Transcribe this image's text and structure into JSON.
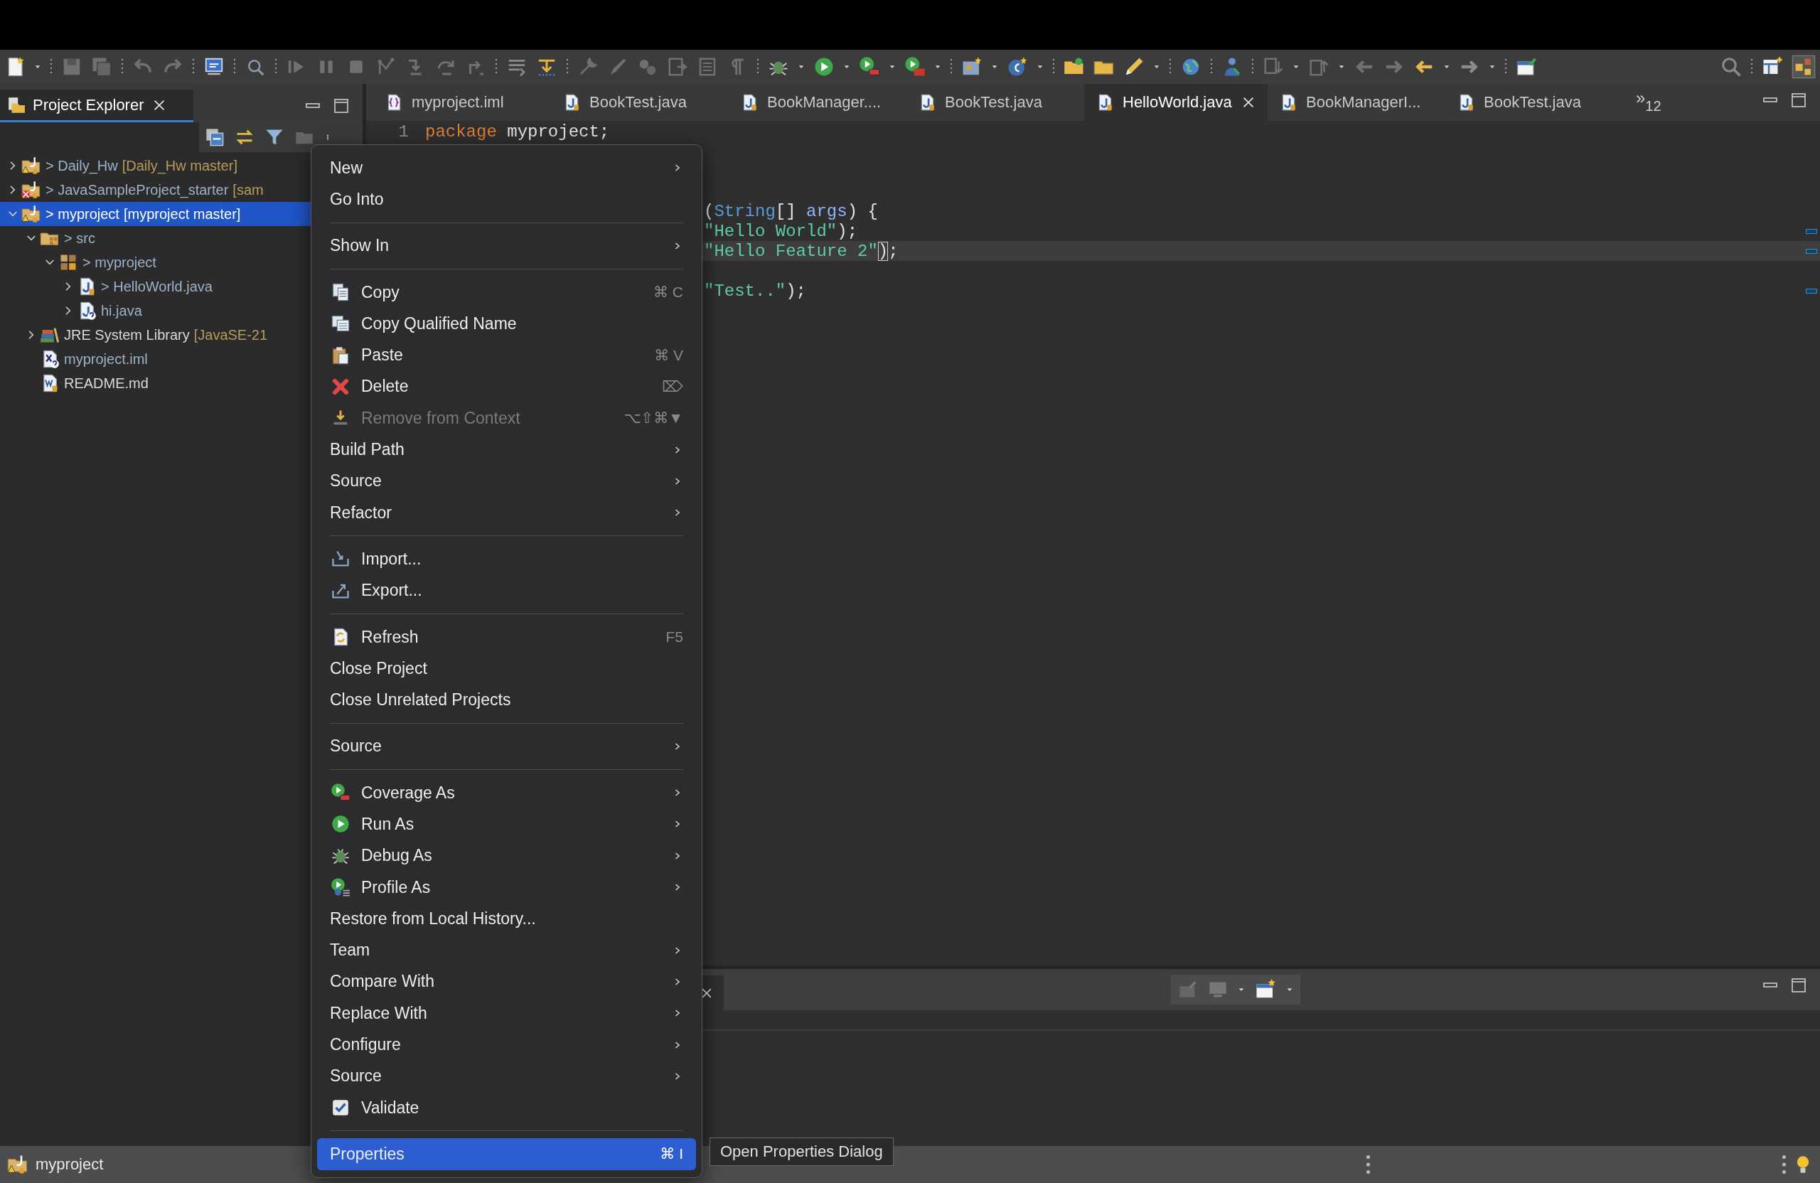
{
  "explorer": {
    "title": "Project Explorer",
    "tree": [
      {
        "label": "> Daily_Hw",
        "decoration": "[Daily_Hw master]",
        "kind": "project",
        "changed": true,
        "selected": false,
        "expanded": false
      },
      {
        "label": "> JavaSampleProject_starter",
        "decoration": "[sam",
        "kind": "project-error",
        "changed": true,
        "selected": false,
        "expanded": false
      },
      {
        "label": "> myproject",
        "decoration": "[myproject master]",
        "kind": "project",
        "changed": true,
        "selected": true,
        "expanded": true,
        "children": [
          {
            "label": "> src",
            "kind": "source-folder",
            "changed": true,
            "selected": false,
            "expanded": true,
            "children": [
              {
                "label": "> myproject",
                "kind": "package",
                "changed": true,
                "selected": false,
                "expanded": true,
                "children": [
                  {
                    "label": "> HelloWorld.java",
                    "kind": "java",
                    "changed": true,
                    "selected": false,
                    "expanded": false
                  },
                  {
                    "label": "hi.java",
                    "kind": "java-untracked",
                    "changed": true,
                    "selected": false,
                    "expanded": false
                  }
                ]
              }
            ]
          },
          {
            "label": "JRE System Library",
            "decoration": "[JavaSE-21",
            "kind": "library",
            "changed": false,
            "selected": false,
            "expanded": false
          },
          {
            "label": "myproject.iml",
            "kind": "xml",
            "changed": true,
            "selected": false
          },
          {
            "label": "README.md",
            "kind": "markdown",
            "changed": false,
            "selected": false
          }
        ]
      }
    ]
  },
  "editor": {
    "tabs": [
      {
        "label": "myproject.iml",
        "kind": "iml",
        "selected": false
      },
      {
        "label": "BookTest.java",
        "kind": "java",
        "selected": false
      },
      {
        "label": "BookManager....",
        "kind": "java",
        "selected": false
      },
      {
        "label": "BookTest.java",
        "kind": "java",
        "selected": false
      },
      {
        "label": "HelloWorld.java",
        "kind": "java",
        "selected": true
      },
      {
        "label": "BookManagerI...",
        "kind": "java",
        "selected": false
      },
      {
        "label": "BookTest.java",
        "kind": "java",
        "selected": false
      }
    ],
    "overflow": {
      "chevron": "»",
      "count": "12"
    },
    "lines": [
      {
        "number": "1",
        "kind": "full",
        "current": false,
        "ruler_mark": false,
        "tokens": [
          {
            "kind": "keyword",
            "text": "package"
          },
          {
            "kind": "plain",
            "text": " myproject;"
          }
        ]
      },
      {
        "kind": "blank"
      },
      {
        "kind": "blank"
      },
      {
        "kind": "blank"
      },
      {
        "kind": "partial",
        "current": false,
        "ruler_mark": false,
        "tokens": [
          {
            "kind": "plain",
            "text": "("
          },
          {
            "kind": "type",
            "text": "String"
          },
          {
            "kind": "plain",
            "text": "[] "
          },
          {
            "kind": "param",
            "text": "args"
          },
          {
            "kind": "plain",
            "text": ") {"
          }
        ]
      },
      {
        "kind": "partial",
        "current": false,
        "ruler_mark": true,
        "tokens": [
          {
            "kind": "string",
            "text": "\"Hello World\""
          },
          {
            "kind": "plain",
            "text": ");"
          }
        ]
      },
      {
        "kind": "partial",
        "current": true,
        "ruler_mark": true,
        "tokens": [
          {
            "kind": "string",
            "text": "\"Hello Feature 2\""
          },
          {
            "kind": "match",
            "text": ")"
          },
          {
            "kind": "plain",
            "text": ";"
          }
        ]
      },
      {
        "kind": "blank"
      },
      {
        "kind": "partial",
        "current": false,
        "ruler_mark": true,
        "tokens": [
          {
            "kind": "string",
            "text": "\"Test..\""
          },
          {
            "kind": "plain",
            "text": ");"
          }
        ]
      }
    ]
  },
  "context_menu": {
    "groups": [
      {
        "items": [
          {
            "label": "New",
            "kind": "plain",
            "submenu": true,
            "selected": false
          },
          {
            "label": "Go Into",
            "kind": "plain",
            "submenu": false,
            "selected": false
          }
        ]
      },
      {
        "items": [
          {
            "label": "Show In",
            "kind": "plain",
            "submenu": true,
            "selected": false
          }
        ]
      },
      {
        "items": [
          {
            "label": "Copy",
            "kind": "copy",
            "shortcut": "⌘ C",
            "submenu": false,
            "selected": false
          },
          {
            "label": "Copy Qualified Name",
            "kind": "copy-name",
            "submenu": false,
            "selected": false
          },
          {
            "label": "Paste",
            "kind": "paste",
            "shortcut": "⌘ V",
            "submenu": false,
            "selected": false
          },
          {
            "label": "Delete",
            "kind": "delete",
            "shortcut": "⌦",
            "submenu": false,
            "selected": false
          },
          {
            "label": "Remove from Context",
            "kind": "remove",
            "shortcut": "⌥⇧⌘▼",
            "submenu": false,
            "selected": false,
            "disabled": true
          },
          {
            "label": "Build Path",
            "kind": "plain",
            "submenu": true,
            "selected": false
          },
          {
            "label": "Source",
            "kind": "plain",
            "submenu": true,
            "selected": false
          },
          {
            "label": "Refactor",
            "kind": "plain",
            "submenu": true,
            "selected": false
          }
        ]
      },
      {
        "items": [
          {
            "label": "Import...",
            "kind": "import",
            "submenu": false,
            "selected": false
          },
          {
            "label": "Export...",
            "kind": "export",
            "submenu": false,
            "selected": false
          }
        ]
      },
      {
        "items": [
          {
            "label": "Refresh",
            "kind": "refresh",
            "shortcut": "F5",
            "submenu": false,
            "selected": false
          },
          {
            "label": "Close Project",
            "kind": "plain",
            "submenu": false,
            "selected": false
          },
          {
            "label": "Close Unrelated Projects",
            "kind": "plain",
            "submenu": false,
            "selected": false
          }
        ]
      },
      {
        "items": [
          {
            "label": "Source",
            "kind": "plain",
            "submenu": true,
            "selected": false
          }
        ]
      },
      {
        "items": [
          {
            "label": "Coverage As",
            "kind": "coverage",
            "submenu": true,
            "selected": false
          },
          {
            "label": "Run As",
            "kind": "run",
            "submenu": true,
            "selected": false
          },
          {
            "label": "Debug As",
            "kind": "debug",
            "submenu": true,
            "selected": false
          },
          {
            "label": "Profile As",
            "kind": "profile",
            "submenu": true,
            "selected": false
          },
          {
            "label": "Restore from Local History...",
            "kind": "plain",
            "submenu": false,
            "selected": false
          },
          {
            "label": "Team",
            "kind": "plain",
            "submenu": true,
            "selected": false
          },
          {
            "label": "Compare With",
            "kind": "plain",
            "submenu": true,
            "selected": false
          },
          {
            "label": "Replace With",
            "kind": "plain",
            "submenu": true,
            "selected": false
          },
          {
            "label": "Configure",
            "kind": "plain",
            "submenu": true,
            "selected": false
          },
          {
            "label": "Source",
            "kind": "plain",
            "submenu": true,
            "selected": false
          },
          {
            "label": "Validate",
            "kind": "checkbox",
            "checked": true,
            "submenu": false,
            "selected": false
          }
        ]
      },
      {
        "items": [
          {
            "label": "Properties",
            "kind": "plain",
            "shortcut": "⌘ I",
            "submenu": false,
            "selected": true
          }
        ]
      }
    ]
  },
  "tooltip": "Open Properties Dialog",
  "status_bar": {
    "label": "myproject"
  }
}
